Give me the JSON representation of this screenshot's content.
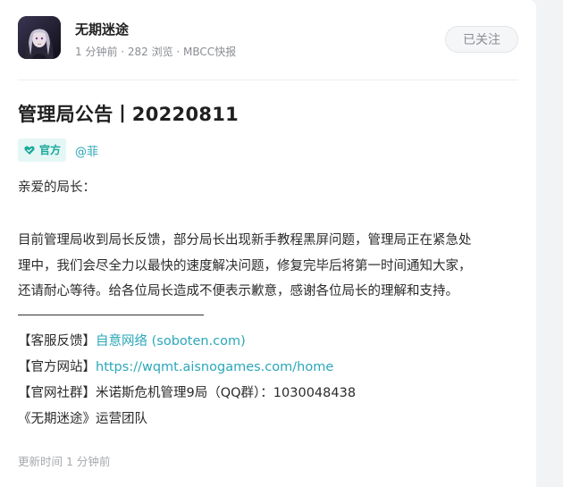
{
  "author": {
    "name": "无期迷途",
    "meta": "1 分钟前 · 282 浏览 · MBCC快报"
  },
  "follow_button": "已关注",
  "post": {
    "title": "管理局公告丨20220811",
    "tag_official": "官方",
    "mention": "@菲",
    "greeting": "亲爱的局长：",
    "paragraph_lines": [
      "目前管理局收到局长反馈，部分局长出现新手教程黑屏问题，管理局正在紧急处",
      "理中，我们会尽全力以最快的速度解决问题，修复完毕后将第一时间通知大家，",
      "还请耐心等待。给各位局长造成不便表示歉意，感谢各位局长的理解和支持。"
    ],
    "service_label": "【客服反馈】",
    "service_link": "自意网络 (soboten.com)",
    "website_label": "【官方网站】",
    "website_link": "https://wqmt.aisnogames.com/home",
    "community_line": "【官网社群】米诺斯危机管理9局（QQ群）：1030048438",
    "signature": "《无期迷途》运营团队"
  },
  "footer": {
    "updated": "更新时间 1 分钟前"
  },
  "colors": {
    "accent": "#2ba7b8",
    "tag_bg": "#e4f7f5",
    "tag_text": "#1aa89b"
  }
}
